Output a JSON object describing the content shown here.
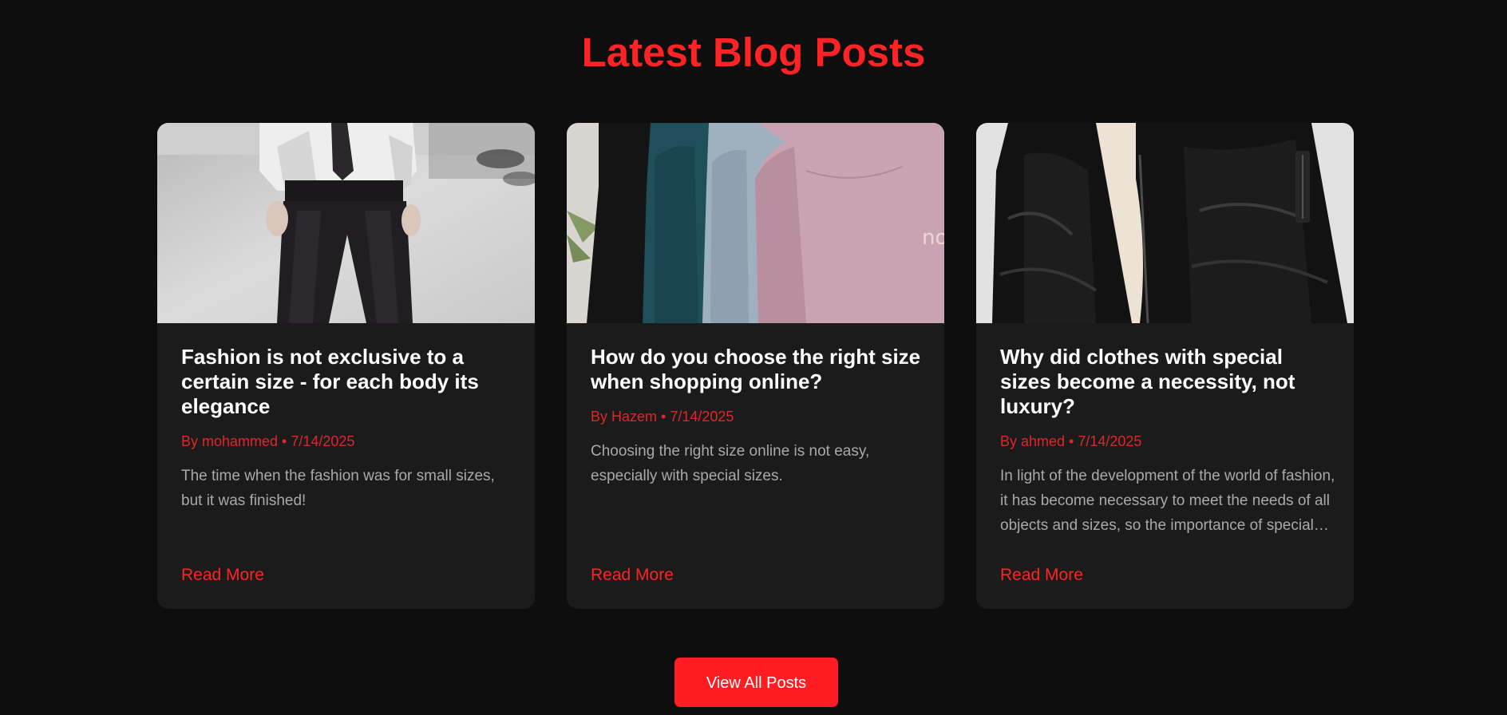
{
  "section": {
    "title": "Latest Blog Posts"
  },
  "posts": [
    {
      "title": "Fashion is not exclusive to a certain size - for each body its elegance",
      "author_line": "By mohammed • 7/14/2025",
      "excerpt": "The time when the fashion was for small sizes, but it was finished!",
      "read_more": "Read More",
      "image": "photo-runway-suit-trousers"
    },
    {
      "title": "How do you choose the right size when shopping online?",
      "author_line": "By Hazem • 7/14/2025",
      "excerpt": "Choosing the right size online is not easy, especially with special sizes.",
      "read_more": "Read More",
      "image": "photo-sweatshirts-on-rack",
      "image_text": "no"
    },
    {
      "title": "Why did clothes with special sizes become a necessity, not luxury?",
      "author_line": "By ahmed • 7/14/2025",
      "excerpt": "In light of the development of the world of fashion, it has become necessary to meet the needs of all objects and sizes, so the importance of special sizes became clear.",
      "read_more": "Read More",
      "image": "photo-black-bomber-jacket"
    }
  ],
  "footer": {
    "view_all_label": "View All Posts"
  },
  "colors": {
    "background": "#0e0e0f",
    "card": "#1b1b1c",
    "accent": "#ff2326",
    "title_text": "#ffffff",
    "body_text": "#a9a9a9"
  }
}
